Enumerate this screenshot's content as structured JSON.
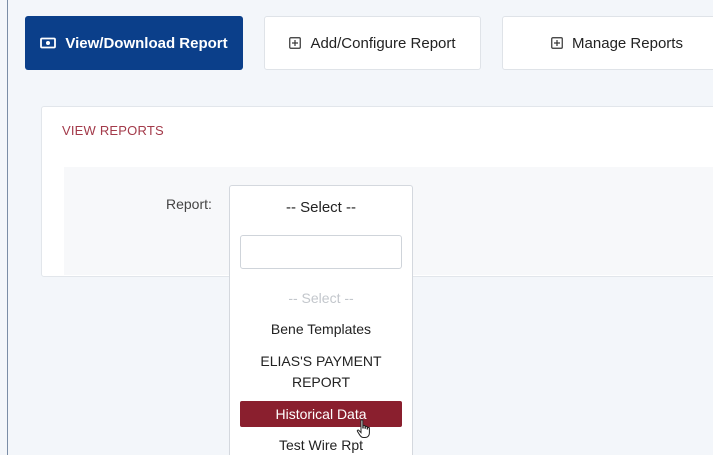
{
  "tabs": {
    "view_download": "View/Download Report",
    "add_configure": "Add/Configure Report",
    "manage": "Manage Reports"
  },
  "icons": {
    "view_download": "view-report-icon",
    "add_configure": "plus-square-icon",
    "manage": "plus-square-icon"
  },
  "card": {
    "title": "VIEW REPORTS"
  },
  "form": {
    "report_label": "Report:",
    "selected_value": "-- Select --"
  },
  "dropdown": {
    "search_value": "",
    "options": [
      "-- Select --",
      "Bene Templates",
      "ELIAS'S PAYMENT REPORT",
      "Historical Data",
      "Test Wire Rpt"
    ],
    "highlighted_option": "Historical Data"
  },
  "colors": {
    "primary": "#0b3f8a",
    "accent": "#a33a4a",
    "highlight": "#8a1f2e"
  }
}
